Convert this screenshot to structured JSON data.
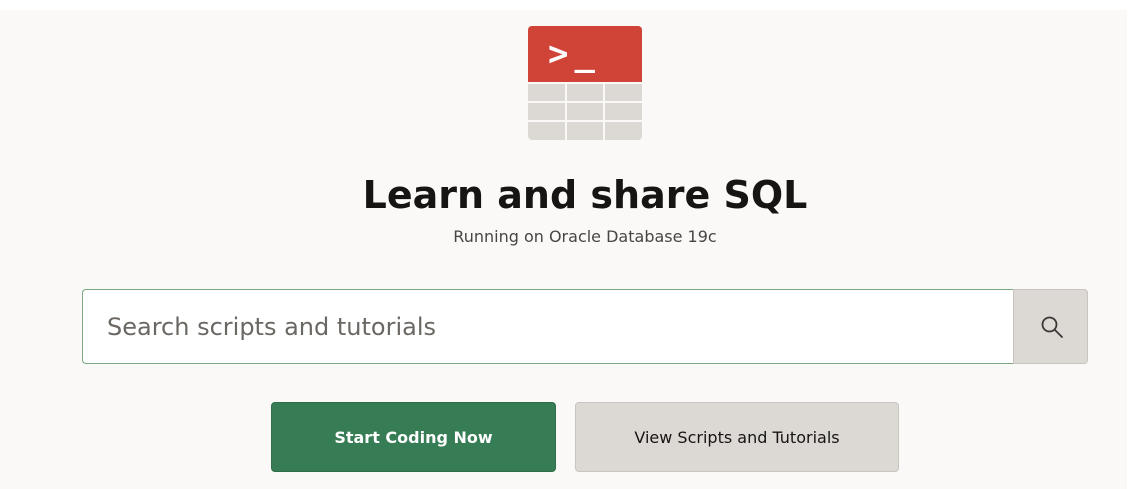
{
  "hero": {
    "logo_prompt": ">_",
    "title": "Learn and share SQL",
    "subtitle": "Running on Oracle Database 19c"
  },
  "search": {
    "placeholder": "Search scripts and tutorials",
    "value": "",
    "button_icon": "search-icon"
  },
  "actions": {
    "primary_label": "Start Coding Now",
    "secondary_label": "View Scripts and Tutorials"
  },
  "colors": {
    "brand_red": "#d04437",
    "primary_green": "#367c54",
    "secondary_gray": "#dcd8d4",
    "background": "#faf9f8"
  }
}
